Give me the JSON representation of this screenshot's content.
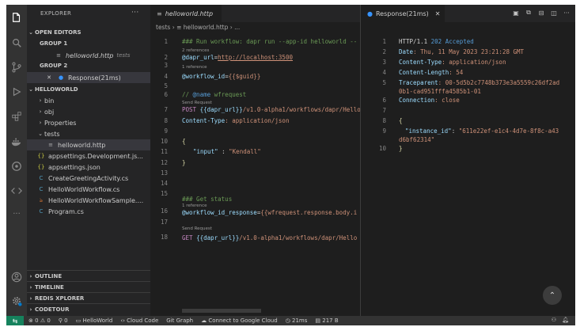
{
  "colors": {
    "accent": "#007acc",
    "statusbar": "#333333",
    "remote": "#16825d"
  },
  "sidebar": {
    "title": "EXPLORER",
    "open_editors": "OPEN EDITORS",
    "group1": "GROUP 1",
    "group1_file": "helloworld.http",
    "group1_file_sub": "tests",
    "group2": "GROUP 2",
    "group2_file": "Response(21ms)",
    "project": "HELLOWORLD",
    "tree": [
      {
        "label": "bin",
        "icon": "chevron-right"
      },
      {
        "label": "obj",
        "icon": "chevron-right"
      },
      {
        "label": "Properties",
        "icon": "chevron-right"
      },
      {
        "label": "tests",
        "icon": "chevron-down"
      },
      {
        "label": "helloworld.http",
        "icon": "http-file"
      },
      {
        "label": "appsettings.Development.js...",
        "icon": "json-file"
      },
      {
        "label": "appsettings.json",
        "icon": "json-file"
      },
      {
        "label": "CreateGreetingActivity.cs",
        "icon": "cs-file"
      },
      {
        "label": "HelloWorldWorkflow.cs",
        "icon": "cs-file"
      },
      {
        "label": "HelloWorldWorkflowSample....",
        "icon": "rss-file"
      },
      {
        "label": "Program.cs",
        "icon": "cs-file"
      }
    ],
    "sections": [
      "OUTLINE",
      "TIMELINE",
      "REDIS XPLORER",
      "CODETOUR"
    ]
  },
  "editor1": {
    "tab": "helloworld.http",
    "breadcrumb_folder": "tests",
    "breadcrumb_file": "helloworld.http",
    "breadcrumb_more": "...",
    "line_numbers": [
      "1",
      "2",
      "3",
      "4",
      "5",
      "6",
      "7",
      "8",
      "9",
      "10",
      "11",
      "12",
      "13",
      "14",
      "15",
      "16",
      "17",
      "18"
    ],
    "lens_refs2": "2 references",
    "lens_ref1": "1 reference",
    "lens_send": "Send Request",
    "lens_ref1b": "1 reference",
    "lens_send2": "Send Request",
    "l1": "### Run workflow: dapr run --app-id helloworld --",
    "l2_var": "@dapr_url",
    "l2_eq": "=",
    "l2_val": "http://localhost:3500",
    "l4_var": "@workflow_id",
    "l4_eq": "=",
    "l4_val": "{{$guid}}",
    "l6_comment": "// ",
    "l6_name": "@name",
    "l6_rest": " wfrequest",
    "l7_method": "POST ",
    "l7_var": "{{dapr_url}}",
    "l7_path": "/v1.0-alpha1/workflows/dapr/Hello",
    "l8_key": "Content-Type",
    "l8_val": ": application/json",
    "l9_brace": "{",
    "l10_key": "\"input\"",
    "l10_colon": " : ",
    "l10_val": "\"Kendall\"",
    "l11_brace": "}",
    "l15": "### Get status",
    "l16_var": "@workflow_id_response",
    "l16_eq": "=",
    "l16_val": "{{wfrequest.response.body.i",
    "l18_method": "GET ",
    "l18_var": "{{dapr_url}}",
    "l18_path": "/v1.0-alpha1/workflows/dapr/Hello"
  },
  "editor2": {
    "tab": "Response(21ms)",
    "line_numbers": [
      "1",
      "2",
      "3",
      "4",
      "5",
      "6",
      "7",
      "8",
      "9",
      "10"
    ],
    "r1a": "HTTP/1.1 ",
    "r1b": "202 Accepted",
    "r2k": "Date",
    "r2v": ": Thu, 11 May 2023 23:21:28 GMT",
    "r3k": "Content-Type",
    "r3v": ": application/json",
    "r4k": "Content-Length",
    "r4v": ": 54",
    "r5k": "Traceparent",
    "r5v": ": 00-5d5b2c7748b373e3a5559c26df2ad",
    "r5v2": "0b1-cad951fffa4585b1-01",
    "r6k": "Connection",
    "r6v": ": close",
    "r8": "{",
    "r9k": "\"instance_id\"",
    "r9c": ": ",
    "r9v": "\"611e22ef-e1c4-4d7e-8f8c-a43",
    "r9v2": "d6bf62314\"",
    "r10": "}"
  },
  "statusbar": {
    "errors": "0",
    "warnings": "0",
    "ports": "0",
    "project": "HelloWorld",
    "cloud": "Cloud Code",
    "graph": "Git Graph",
    "connect": "Connect to Google Cloud",
    "time": "21ms",
    "size": "217 B"
  }
}
